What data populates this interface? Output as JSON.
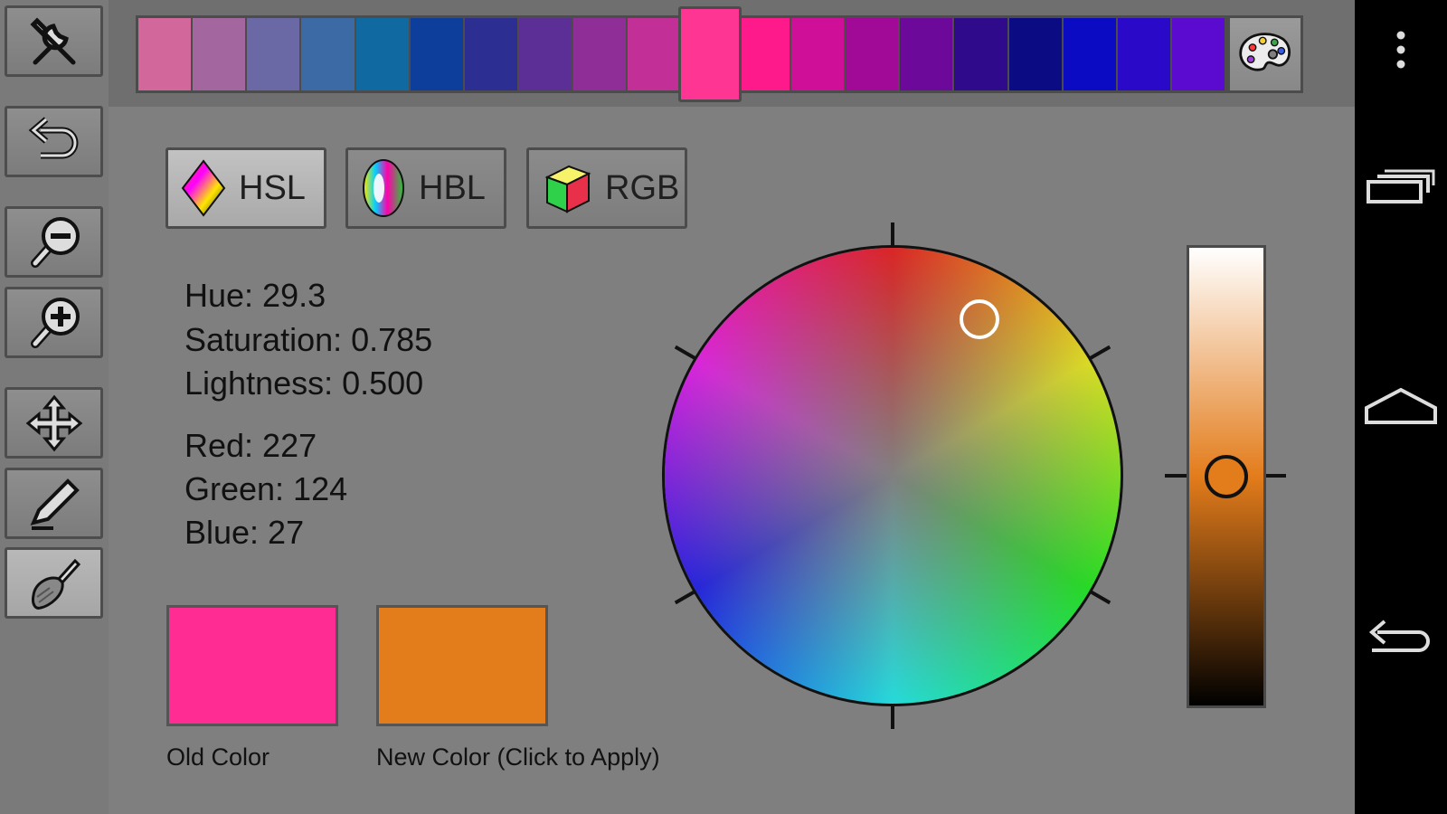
{
  "toolbar": {
    "tools": [
      {
        "name": "tools-icon"
      },
      {
        "name": "undo-icon"
      },
      {
        "name": "zoom-out-icon"
      },
      {
        "name": "zoom-in-icon"
      },
      {
        "name": "move-icon"
      },
      {
        "name": "pen-icon"
      },
      {
        "name": "brush-icon",
        "selected": true
      }
    ]
  },
  "palette": {
    "swatches": [
      "#d2679b",
      "#a4669f",
      "#6b68a6",
      "#3b6aa4",
      "#1169a2",
      "#0e3e9b",
      "#2d2e91",
      "#5b2f95",
      "#8e2e96",
      "#c22f97",
      "#ff2d91",
      "#ff1a8c",
      "#d00f98",
      "#a00a97",
      "#6d099a",
      "#2f0b8b",
      "#0b0b84",
      "#0b0bc3",
      "#2a0ac8",
      "#5b0ad0"
    ],
    "selected_index": 10,
    "selected_color": "#ff3593",
    "palette_button_icon": "palette-icon"
  },
  "modes": [
    {
      "label": "HSL",
      "icon": "hsl-diamond-icon",
      "active": true
    },
    {
      "label": "HBL",
      "icon": "hbl-oval-icon",
      "active": false
    },
    {
      "label": "RGB",
      "icon": "rgb-cube-icon",
      "active": false
    }
  ],
  "values": {
    "hue": "Hue: 29.3",
    "saturation": "Saturation: 0.785",
    "lightness": "Lightness: 0.500",
    "red": "Red: 227",
    "green": "Green: 124",
    "blue": "Blue: 27"
  },
  "old_color": {
    "label": "Old Color",
    "hex": "#ff2d93"
  },
  "new_color": {
    "label": "New Color (Click to Apply)",
    "hex": "#e37c1b"
  },
  "lightness_slider": {
    "value": 0.5
  },
  "navbar": {
    "icons": [
      "overflow-menu-icon",
      "recents-icon",
      "home-icon",
      "back-icon"
    ]
  }
}
